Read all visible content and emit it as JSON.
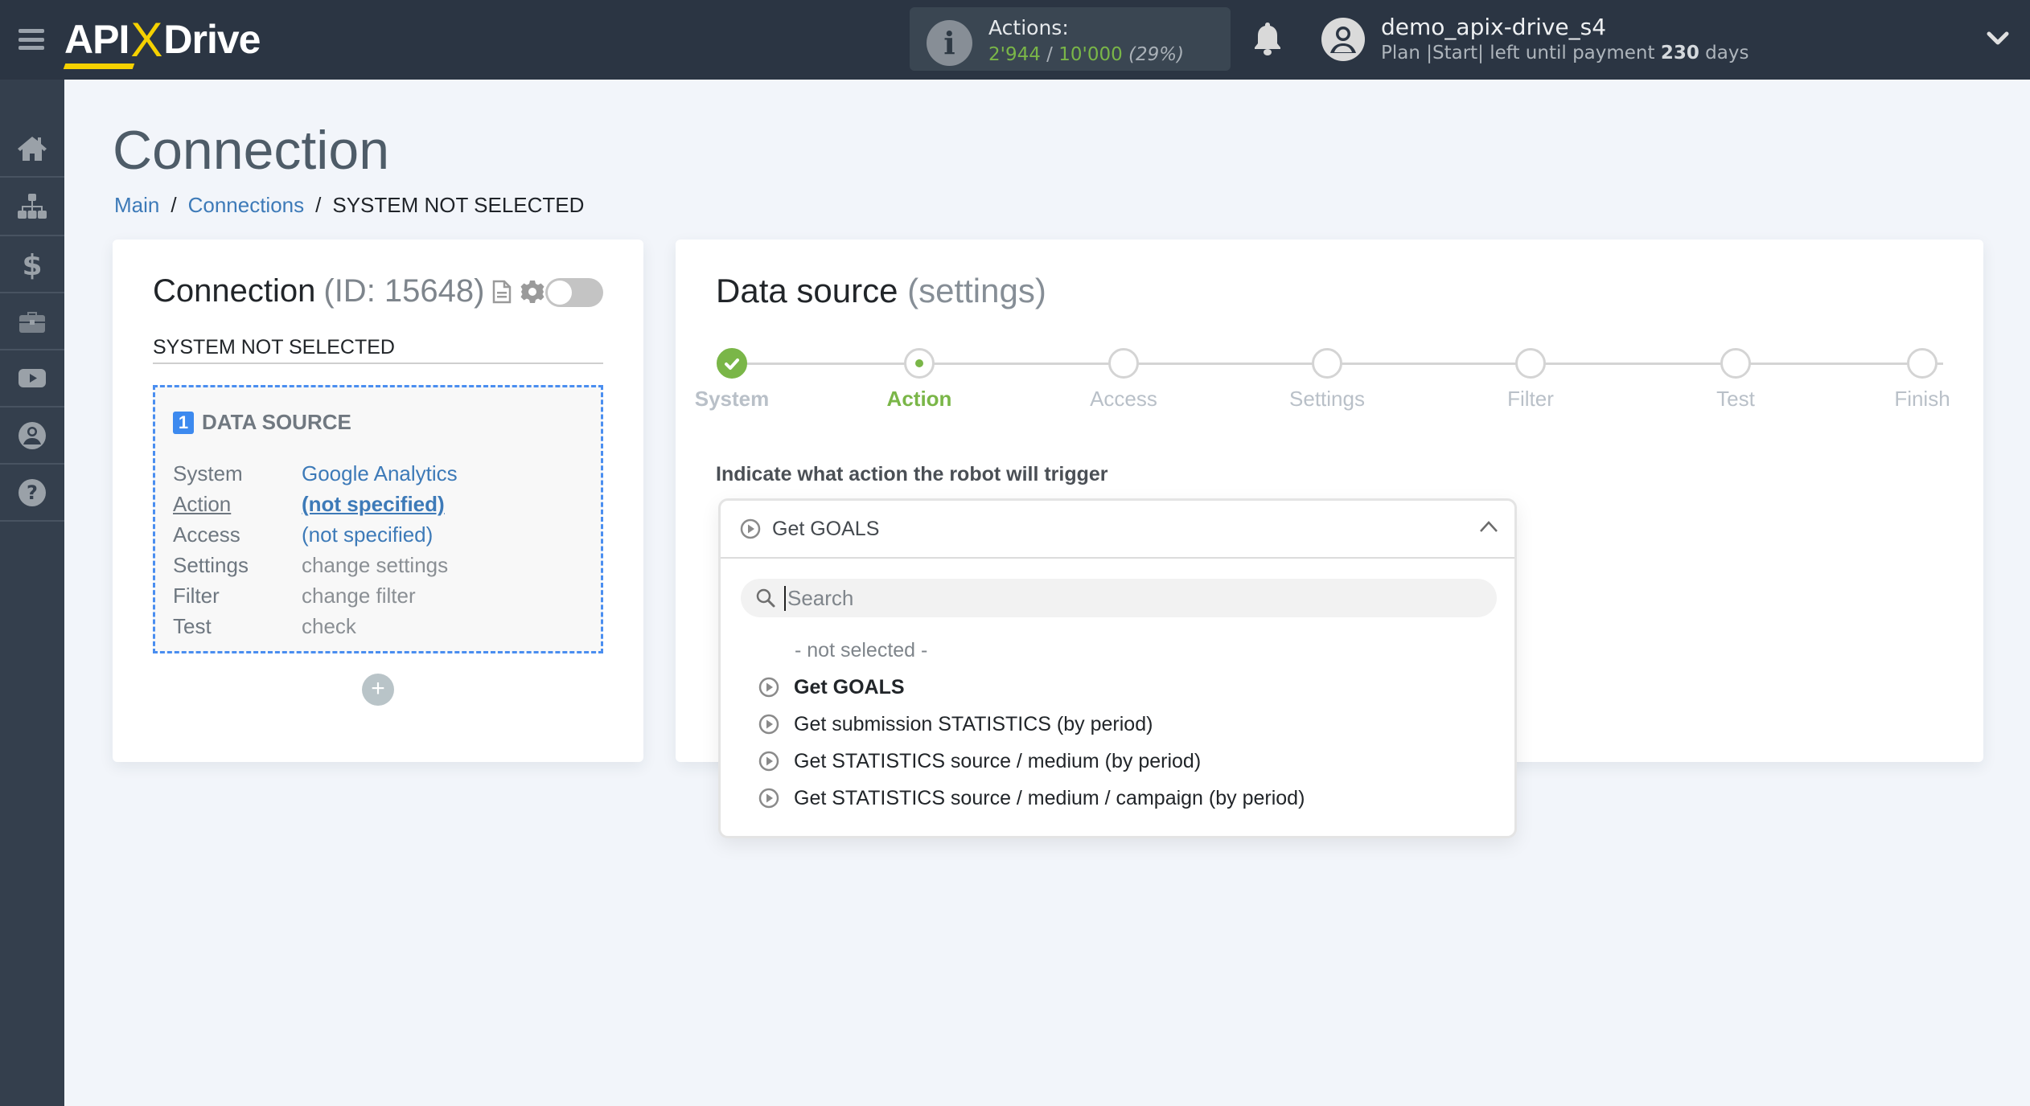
{
  "header": {
    "logo": {
      "api": "API",
      "x": "X",
      "drive": "Drive"
    },
    "actions": {
      "label": "Actions:",
      "used": "2'944",
      "separator": "/",
      "total": "10'000",
      "percent": "(29%)"
    },
    "user": {
      "name": "demo_apix-drive_s4",
      "plan_prefix": "Plan |Start| left until payment",
      "days_count": "230",
      "days_suffix": "days"
    }
  },
  "sidebar": {
    "items": [
      {
        "name": "home",
        "icon": "home-icon"
      },
      {
        "name": "connections",
        "icon": "sitemap-icon"
      },
      {
        "name": "billing",
        "icon": "dollar-icon"
      },
      {
        "name": "services",
        "icon": "briefcase-icon"
      },
      {
        "name": "videos",
        "icon": "youtube-icon"
      },
      {
        "name": "account",
        "icon": "user-circle-icon"
      },
      {
        "name": "help",
        "icon": "question-circle-icon"
      }
    ]
  },
  "page": {
    "title": "Connection",
    "breadcrumb": [
      {
        "label": "Main"
      },
      {
        "label": "Connections"
      },
      {
        "label": "SYSTEM NOT SELECTED"
      }
    ],
    "breadcrumb_sep": "/"
  },
  "connection_card": {
    "title": "Connection",
    "id_text": "(ID: 15648)",
    "enabled": false,
    "name": "SYSTEM NOT SELECTED",
    "data_source": {
      "number": "1",
      "title": "DATA SOURCE",
      "rows": [
        {
          "key": "System",
          "value": "Google Analytics"
        },
        {
          "key": "Action",
          "value": "(not specified)"
        },
        {
          "key": "Access",
          "value": "(not specified)"
        },
        {
          "key": "Settings",
          "value": "change settings"
        },
        {
          "key": "Filter",
          "value": "change filter"
        },
        {
          "key": "Test",
          "value": "check"
        }
      ]
    },
    "add_label": "+"
  },
  "settings_card": {
    "title": "Data source",
    "subtitle": "(settings)",
    "steps": [
      {
        "label": "System",
        "state": "done"
      },
      {
        "label": "Action",
        "state": "current"
      },
      {
        "label": "Access",
        "state": "pending"
      },
      {
        "label": "Settings",
        "state": "pending"
      },
      {
        "label": "Filter",
        "state": "pending"
      },
      {
        "label": "Test",
        "state": "pending"
      },
      {
        "label": "Finish",
        "state": "pending"
      }
    ],
    "prompt": "Indicate what action the robot will trigger",
    "dropdown": {
      "selected": "Get GOALS",
      "search_placeholder": "Search",
      "search_value": "",
      "options": [
        {
          "label": "- not selected -"
        },
        {
          "label": "Get GOALS"
        },
        {
          "label": "Get submission STATISTICS (by period)"
        },
        {
          "label": "Get STATISTICS source / medium (by period)"
        },
        {
          "label": "Get STATISTICS source / medium / campaign (by period)"
        }
      ]
    }
  },
  "colors": {
    "header_bg": "#2b3543",
    "sidebar_bg": "#343f4d",
    "accent_green": "#7ab648",
    "link_blue": "#3d7ab8",
    "logo_yellow": "#f5d100",
    "dashed_blue": "#4a8ef0"
  }
}
